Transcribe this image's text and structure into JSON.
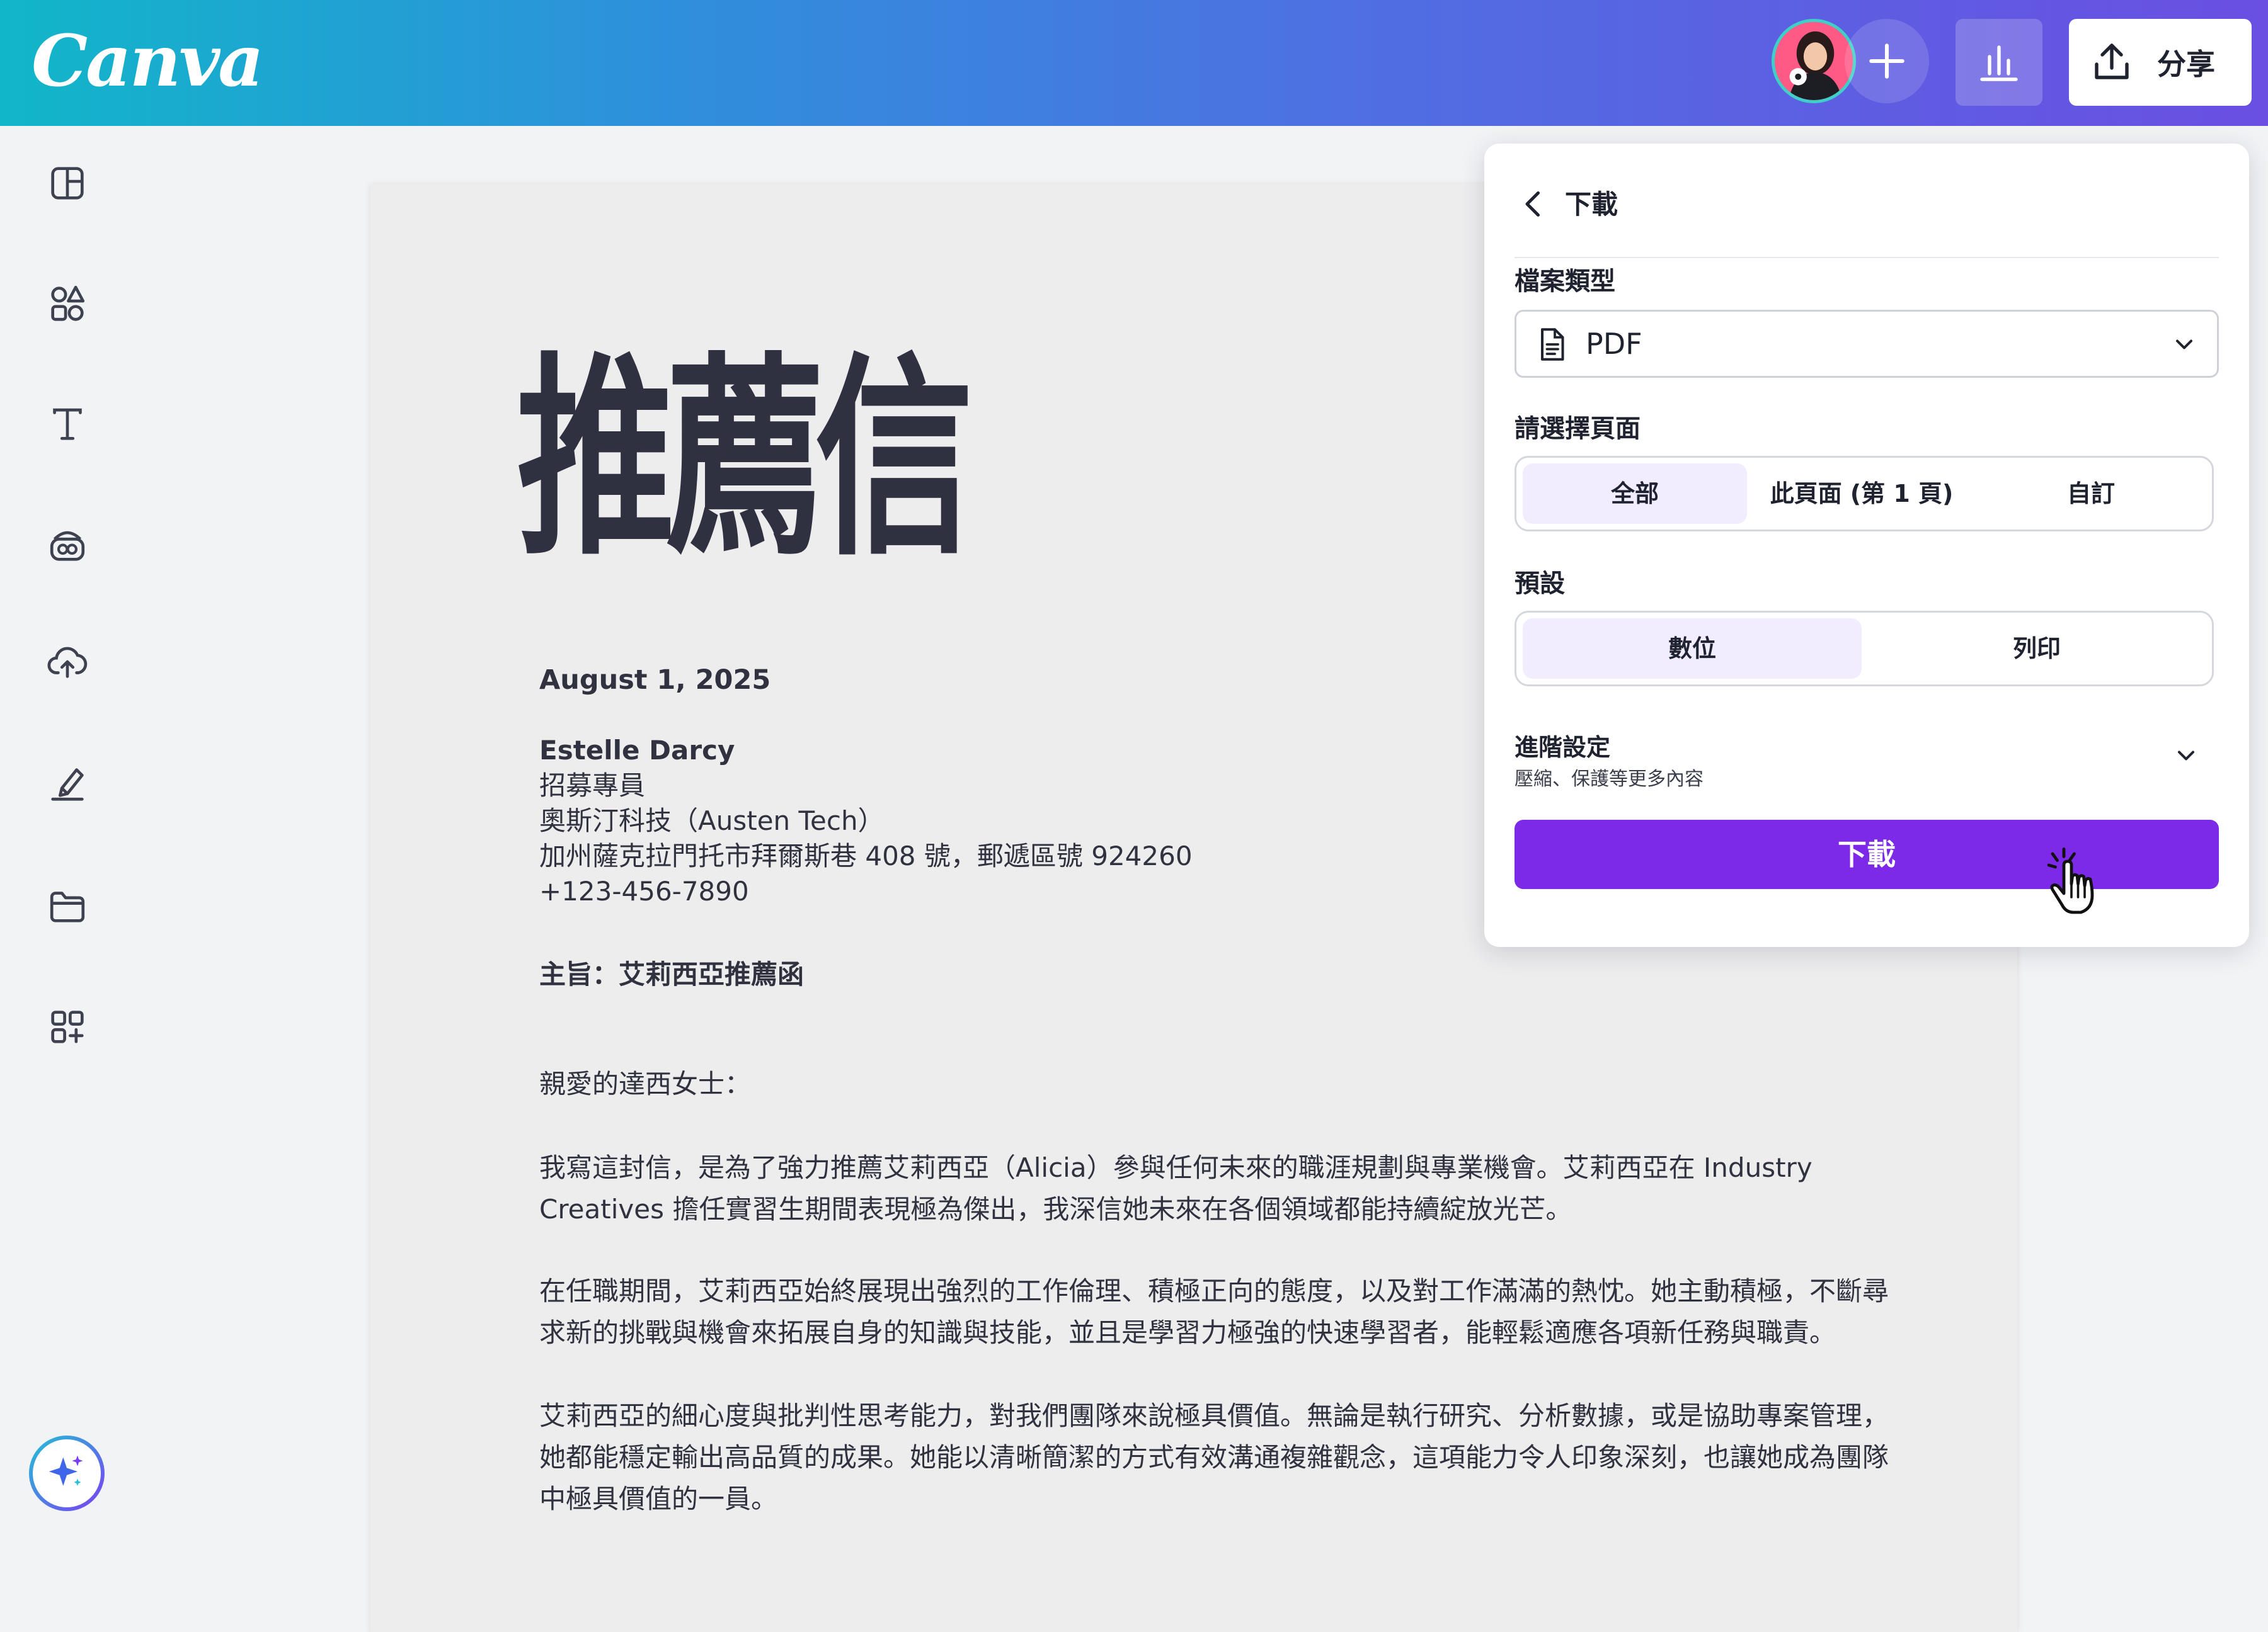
{
  "app": {
    "logo_text": "Canva",
    "accent_color": "#7d2ae8"
  },
  "topbar": {
    "avatar_icon": "user-avatar",
    "add_icon": "plus-icon",
    "stats_icon": "bar-chart-icon",
    "share": {
      "icon": "upload-icon",
      "label": "分享"
    }
  },
  "sidebar": {
    "items": [
      {
        "name": "design",
        "icon": "layout-icon"
      },
      {
        "name": "elements",
        "icon": "shapes-icon"
      },
      {
        "name": "text",
        "icon": "text-icon"
      },
      {
        "name": "brand",
        "icon": "brand-kit-icon"
      },
      {
        "name": "uploads",
        "icon": "cloud-upload-icon"
      },
      {
        "name": "draw",
        "icon": "draw-icon"
      },
      {
        "name": "projects",
        "icon": "folder-icon"
      },
      {
        "name": "apps",
        "icon": "apps-icon"
      }
    ],
    "magic_icon": "magic-sparkle-icon"
  },
  "document": {
    "title": "推薦信",
    "date": "August 1, 2025",
    "recipient": {
      "name": "Estelle Darcy",
      "role": "招募專員",
      "company": "奧斯汀科技（Austen Tech）",
      "address": "加州薩克拉門托市拜爾斯巷 408 號，郵遞區號 924260",
      "phone": "+123-456-7890"
    },
    "subject": "主旨：艾莉西亞推薦函",
    "greeting": "親愛的達西女士：",
    "paragraphs": [
      "我寫這封信，是為了強力推薦艾莉西亞（Alicia）參與任何未來的職涯規劃與專業機會。艾莉西亞在 Industry Creatives 擔任實習生期間表現極為傑出，我深信她未來在各個領域都能持續綻放光芒。",
      "在任職期間，艾莉西亞始終展現出強烈的工作倫理、積極正向的態度，以及對工作滿滿的熱忱。她主動積極，不斷尋求新的挑戰與機會來拓展自身的知識與技能，並且是學習力極強的快速學習者，能輕鬆適應各項新任務與職責。",
      "艾莉西亞的細心度與批判性思考能力，對我們團隊來說極具價值。無論是執行研究、分析數據，或是協助專案管理，她都能穩定輸出高品質的成果。她能以清晰簡潔的方式有效溝通複雜觀念，這項能力令人印象深刻，也讓她成為團隊中極具價值的一員。"
    ]
  },
  "download_panel": {
    "title": "下載",
    "file_type": {
      "label": "檔案類型",
      "value": "PDF"
    },
    "pages": {
      "label": "請選擇頁面",
      "options": [
        "全部",
        "此頁面 (第 1 頁)",
        "自訂"
      ],
      "selected": "全部"
    },
    "preset": {
      "label": "預設",
      "options": [
        "數位",
        "列印"
      ],
      "selected": "數位"
    },
    "advanced": {
      "title": "進階設定",
      "subtitle": "壓縮、保護等更多內容"
    },
    "download_button": "下載"
  }
}
